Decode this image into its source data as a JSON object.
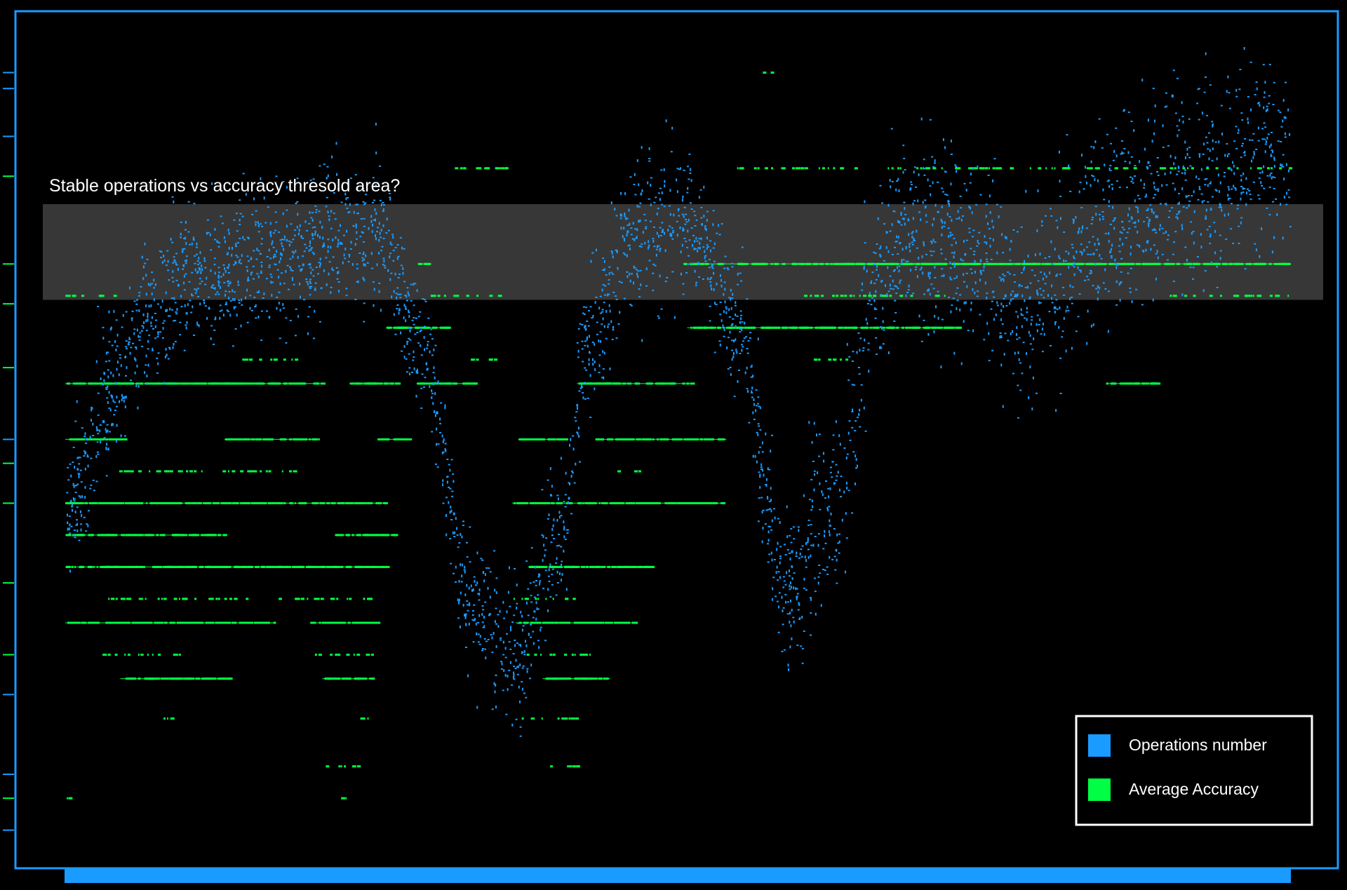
{
  "colors": {
    "background": "#000000",
    "frame": "#1a9bff",
    "operations": "#1a9bff",
    "accuracy": "#00ff44",
    "highlight_band": "#3a3a3a",
    "legend_border": "#ffffff",
    "text": "#ffffff"
  },
  "chart_data": {
    "type": "scatter",
    "title": "",
    "xlabel": "",
    "ylabel": "",
    "grid": false,
    "legend_position": "bottom-right",
    "xlim": [
      0,
      1000
    ],
    "ylim": [
      0,
      100
    ],
    "y_ticks": [
      1,
      5,
      8,
      18,
      23,
      32,
      42,
      47,
      50,
      59,
      67,
      72,
      83,
      88,
      94,
      96
    ],
    "series": [
      {
        "name": "Operations number",
        "color": "#1a9bff",
        "curve": {
          "x": [
            0,
            40,
            70,
            100,
            180,
            220,
            255,
            290,
            330,
            365,
            400,
            430,
            465,
            510,
            545,
            590,
            630,
            660,
            690,
            730,
            780,
            840,
            870,
            900,
            940,
            1000
          ],
          "y": [
            42,
            58,
            66,
            70,
            73,
            75,
            76,
            62,
            30,
            23,
            37,
            63,
            76,
            77,
            66,
            31,
            43,
            70,
            76,
            75,
            67,
            76,
            79,
            81,
            83,
            87
          ]
        },
        "spread": 4.5
      },
      {
        "name": "Average Accuracy",
        "color": "#00ff44",
        "levels": [
          {
            "y": 72,
            "segments": [
              [
                288,
                298
              ],
              [
                505,
                1000
              ]
            ]
          },
          {
            "y": 64,
            "segments": [
              [
                262,
                312
              ],
              [
                508,
                730
              ]
            ]
          },
          {
            "y": 57,
            "segments": [
              [
                0,
                210
              ],
              [
                232,
                270
              ],
              [
                287,
                337
              ],
              [
                418,
                513
              ],
              [
                850,
                892
              ]
            ]
          },
          {
            "y": 50,
            "segments": [
              [
                0,
                47
              ],
              [
                130,
                207
              ],
              [
                255,
                283
              ],
              [
                370,
                410
              ],
              [
                433,
                540
              ]
            ]
          },
          {
            "y": 42,
            "segments": [
              [
                0,
                260
              ],
              [
                365,
                536
              ]
            ]
          },
          {
            "y": 38,
            "segments": [
              [
                0,
                130
              ],
              [
                220,
                268
              ]
            ]
          },
          {
            "y": 34,
            "segments": [
              [
                0,
                262
              ],
              [
                378,
                480
              ]
            ]
          },
          {
            "y": 27,
            "segments": [
              [
                0,
                170
              ],
              [
                200,
                255
              ],
              [
                368,
                465
              ]
            ]
          },
          {
            "y": 20,
            "segments": [
              [
                45,
                135
              ],
              [
                210,
                250
              ],
              [
                390,
                445
              ]
            ]
          }
        ],
        "sparse_levels": [
          {
            "y": 84,
            "segments": [
              [
                315,
                365
              ],
              [
                325,
                360
              ],
              [
                545,
                645
              ],
              [
                670,
                1000
              ]
            ]
          },
          {
            "y": 68,
            "segments": [
              [
                0,
                40
              ],
              [
                296,
                358
              ],
              [
                600,
                720
              ],
              [
                900,
                1000
              ]
            ]
          },
          {
            "y": 60,
            "segments": [
              [
                330,
                360
              ],
              [
                610,
                640
              ],
              [
                140,
                190
              ]
            ]
          },
          {
            "y": 46,
            "segments": [
              [
                40,
                190
              ],
              [
                450,
                470
              ]
            ]
          },
          {
            "y": 30,
            "segments": [
              [
                30,
                250
              ],
              [
                365,
                415
              ]
            ]
          },
          {
            "y": 23,
            "segments": [
              [
                30,
                100
              ],
              [
                200,
                255
              ],
              [
                370,
                430
              ]
            ]
          },
          {
            "y": 15,
            "segments": [
              [
                80,
                95
              ],
              [
                240,
                250
              ],
              [
                370,
                420
              ]
            ]
          },
          {
            "y": 9,
            "segments": [
              [
                210,
                240
              ],
              [
                390,
                420
              ]
            ]
          },
          {
            "y": 5,
            "segments": [
              [
                0,
                5
              ],
              [
                225,
                230
              ]
            ]
          },
          {
            "y": 96,
            "segments": [
              [
                563,
                578
              ]
            ]
          }
        ]
      }
    ],
    "annotations": [
      {
        "text": "Stable operations vs accuracy thresold area?",
        "y_range": [
          67.5,
          79.5
        ]
      }
    ]
  },
  "legend": {
    "items": [
      {
        "label": "Operations number",
        "color": "#1a9bff"
      },
      {
        "label": "Average Accuracy",
        "color": "#00ff44"
      }
    ]
  }
}
